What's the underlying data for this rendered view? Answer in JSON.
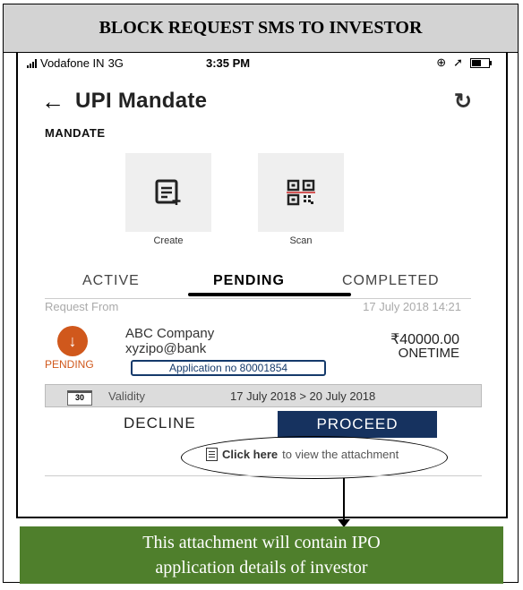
{
  "header": {
    "title": "BLOCK REQUEST SMS TO INVESTOR"
  },
  "status_bar": {
    "carrier": "Vodafone IN",
    "network": "3G",
    "time": "3:35 PM"
  },
  "screen": {
    "title": "UPI Mandate",
    "section_label": "MANDATE",
    "actions": [
      {
        "label": "Create"
      },
      {
        "label": "Scan"
      }
    ],
    "tabs": [
      {
        "label": "ACTIVE",
        "selected": false
      },
      {
        "label": "PENDING",
        "selected": true
      },
      {
        "label": "COMPLETED",
        "selected": false
      }
    ]
  },
  "request": {
    "from_label": "Request From",
    "datetime": "17 July 2018 14:21",
    "status": "PENDING",
    "company": "ABC Company",
    "vpa": "xyzipo@bank",
    "amount": "₹40000.00",
    "frequency": "ONETIME",
    "application_no": "Application no 80001854",
    "validity_icon_text": "30",
    "validity_label": "Validity",
    "validity_range": "17 July 2018 > 20 July 2018",
    "decline_label": "DECLINE",
    "proceed_label": "PROCEED",
    "attachment_link": "Click here",
    "attachment_text": "to view the attachment"
  },
  "caption": {
    "line1": "This attachment will contain IPO",
    "line2": "application details of investor"
  },
  "colors": {
    "pending": "#d0581c",
    "proceed": "#16325f",
    "caption_bg": "#4f7f2c",
    "header_bg": "#d3d3d3"
  }
}
